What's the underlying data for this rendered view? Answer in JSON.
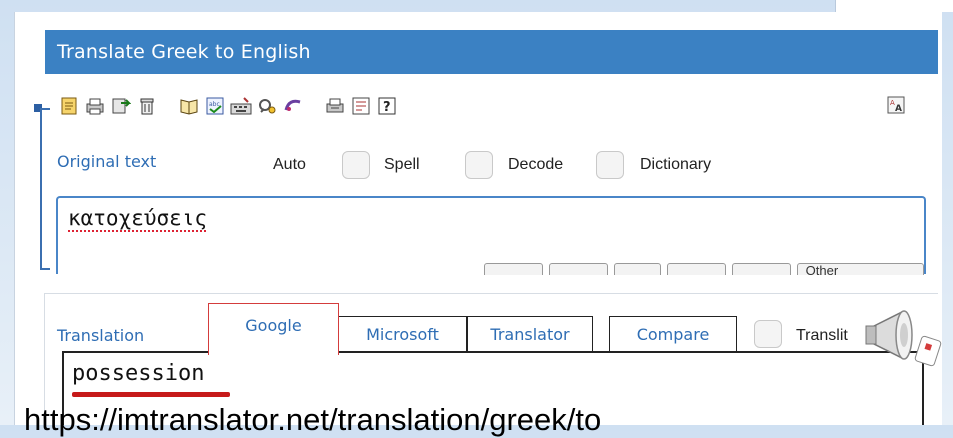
{
  "window": {
    "title": "Translate Greek to English"
  },
  "toolbar": {
    "icons": [
      "clear-text-icon",
      "print-icon",
      "export-icon",
      "delete-icon",
      "dictionary-icon",
      "spellcheck-icon",
      "virtual-keyboard-icon",
      "settings-icon",
      "history-icon",
      "print-preview-icon",
      "font-size-icon",
      "help-icon",
      "translate-settings-icon"
    ]
  },
  "source": {
    "label": "Original text",
    "options": {
      "auto": "Auto",
      "spell": "Spell",
      "decode": "Decode",
      "dictionary": "Dictionary"
    },
    "text": "κατοχεύσεις",
    "keyboard_last": "Other"
  },
  "translation": {
    "label": "Translation",
    "tabs": {
      "google": "Google",
      "microsoft": "Microsoft",
      "translator": "Translator",
      "compare": "Compare"
    },
    "translit": "Translit",
    "result": "possession"
  },
  "overlay": {
    "url": "https://imtranslator.net/translation/greek/to"
  },
  "colors": {
    "accent": "#3b81c3",
    "label": "#2e6db4",
    "active_tab_border": "#d43c3c",
    "underline": "#c61a1a"
  }
}
